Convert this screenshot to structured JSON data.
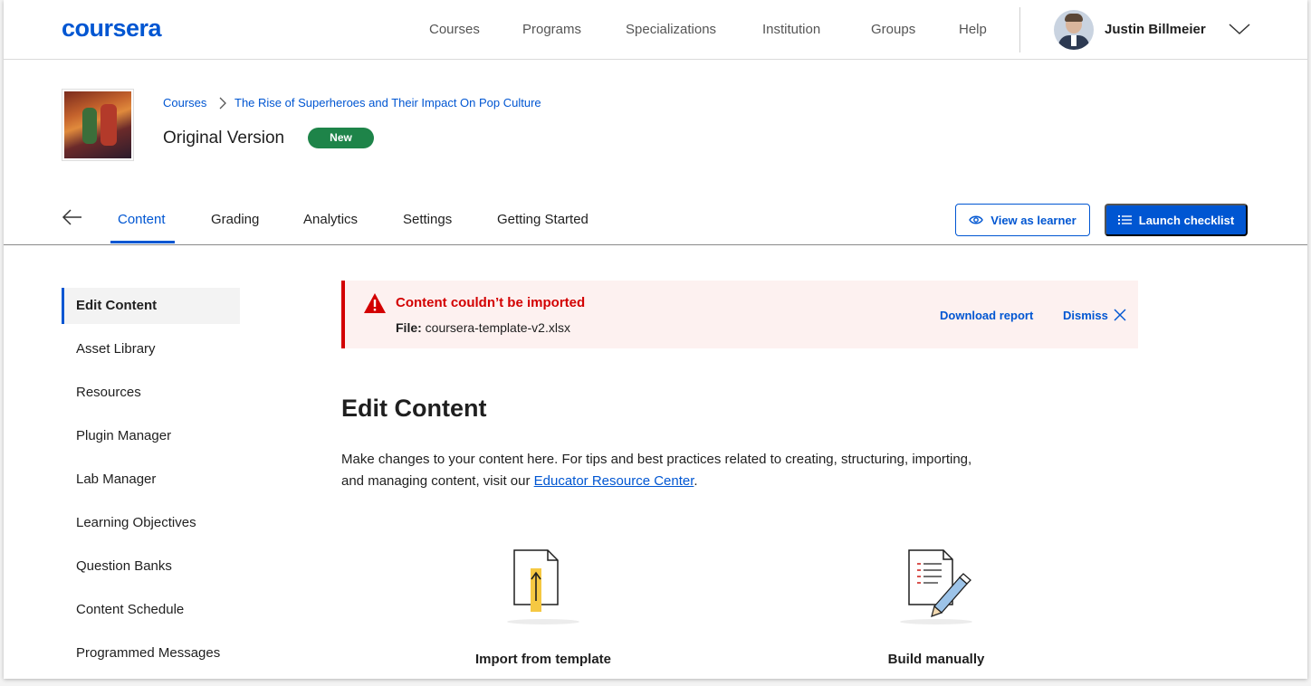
{
  "header": {
    "logo": "coursera",
    "nav": [
      "Courses",
      "Programs",
      "Specializations",
      "Institution",
      "Groups",
      "Help"
    ],
    "user_name": "Justin Billmeier"
  },
  "course": {
    "breadcrumb": [
      "Courses",
      "The Rise of Superheroes and Their Impact On Pop Culture"
    ],
    "version_title": "Original Version",
    "badge": "New"
  },
  "tabs": {
    "items": [
      "Content",
      "Grading",
      "Analytics",
      "Settings",
      "Getting Started"
    ],
    "active": "Content",
    "view_as_learner": "View as learner",
    "launch_checklist": "Launch checklist"
  },
  "sidebar": {
    "items": [
      "Edit Content",
      "Asset Library",
      "Resources",
      "Plugin Manager",
      "Lab Manager",
      "Learning Objectives",
      "Question Banks",
      "Content Schedule",
      "Programmed Messages"
    ],
    "active": "Edit Content"
  },
  "alert": {
    "title": "Content couldn’t be imported",
    "file_label": "File:",
    "file_name": "coursera-template-v2.xlsx",
    "download_report": "Download report",
    "dismiss": "Dismiss"
  },
  "main": {
    "title": "Edit Content",
    "description_before": "Make changes to your content here. For tips and best practices related to creating, structuring, importing, and managing content, visit our ",
    "description_link": "Educator Resource Center",
    "description_after": ".",
    "options": [
      {
        "label": "Import from template",
        "icon": "import-template-icon"
      },
      {
        "label": "Build manually",
        "icon": "build-manually-icon"
      }
    ]
  },
  "colors": {
    "brand": "#0056d2",
    "success": "#1e8449",
    "error": "#d30001",
    "error_bg": "#fdf1f0"
  }
}
